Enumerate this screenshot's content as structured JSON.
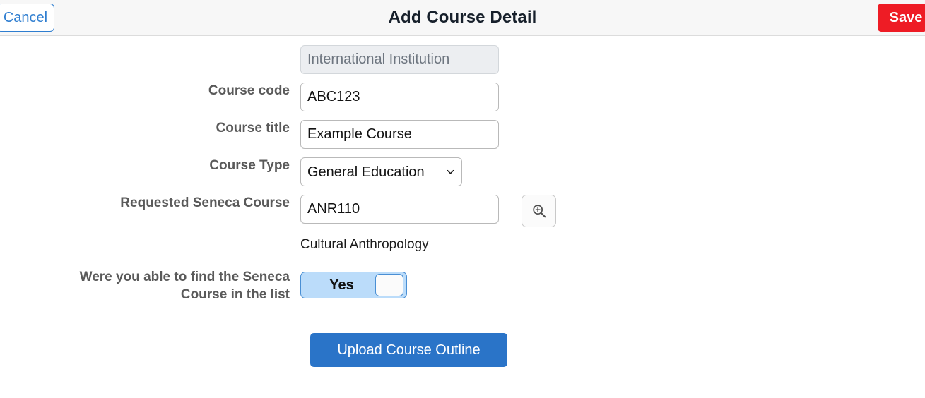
{
  "header": {
    "title": "Add Course Detail",
    "cancel_label": "Cancel",
    "save_label": "Save",
    "save_color": "#ee1c25",
    "cancel_color": "#2f7ed0",
    "background": "#f7f7f7"
  },
  "form": {
    "institution": {
      "label": "",
      "value": "International Institution",
      "placeholder": "International Institution",
      "disabled": true
    },
    "course_code": {
      "label": "Course code",
      "value": "ABC123",
      "placeholder": "Course code"
    },
    "course_title": {
      "label": "Course title",
      "value": "Example Course",
      "placeholder": "Course title"
    },
    "course_type": {
      "label": "Course Type",
      "value": "General Education",
      "options": [
        "General Education"
      ]
    },
    "requested_seneca_course": {
      "label": "Requested Seneca Course",
      "value": "ANR110",
      "placeholder": "Requested Seneca Course",
      "search_icon": "search-zoom-in-icon",
      "result_text": "Cultural Anthropology"
    },
    "found_course_toggle": {
      "label_line1": "Were you able to find the Seneca",
      "label_line2": "Course in the list",
      "value": "Yes",
      "state": "on",
      "accent": "#bbdcfa"
    },
    "upload": {
      "label": "Upload Course Outline",
      "color": "#2a74c8"
    }
  }
}
